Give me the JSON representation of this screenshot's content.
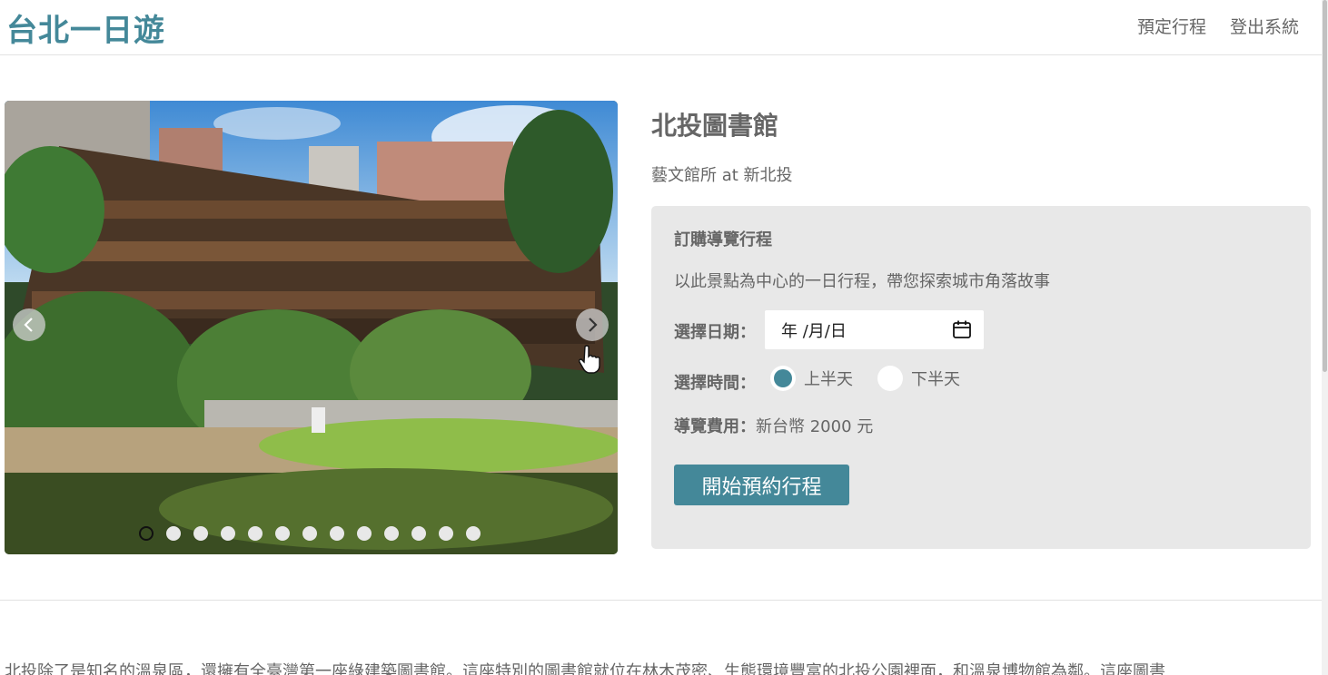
{
  "header": {
    "logo": "台北一日遊",
    "nav": [
      "預定行程",
      "登出系統"
    ]
  },
  "carousel": {
    "dot_count": 13,
    "active_index": 0
  },
  "attraction": {
    "name": "北投圖書館",
    "meta": "藝文館所 at 新北投"
  },
  "booking": {
    "title": "訂購導覽行程",
    "description": "以此景點為中心的一日行程，帶您探索城市角落故事",
    "date_label": "選擇日期：",
    "date_value": "年 /月/日",
    "time_label": "選擇時間：",
    "time_options": [
      "上半天",
      "下半天"
    ],
    "time_selected": 0,
    "fee_label": "導覽費用：",
    "fee_value": "新台幣 2000 元",
    "submit_label": "開始預約行程"
  },
  "description": "北投除了是知名的溫泉區，還擁有全臺灣第一座綠建築圖書館。這座特別的圖書館就位在林木茂密、生態環境豐富的北投公園裡面，和溫泉博物館為鄰。這座圖書",
  "colors": {
    "accent": "#448899",
    "panel": "#e8e8e8",
    "text": "#666666"
  }
}
